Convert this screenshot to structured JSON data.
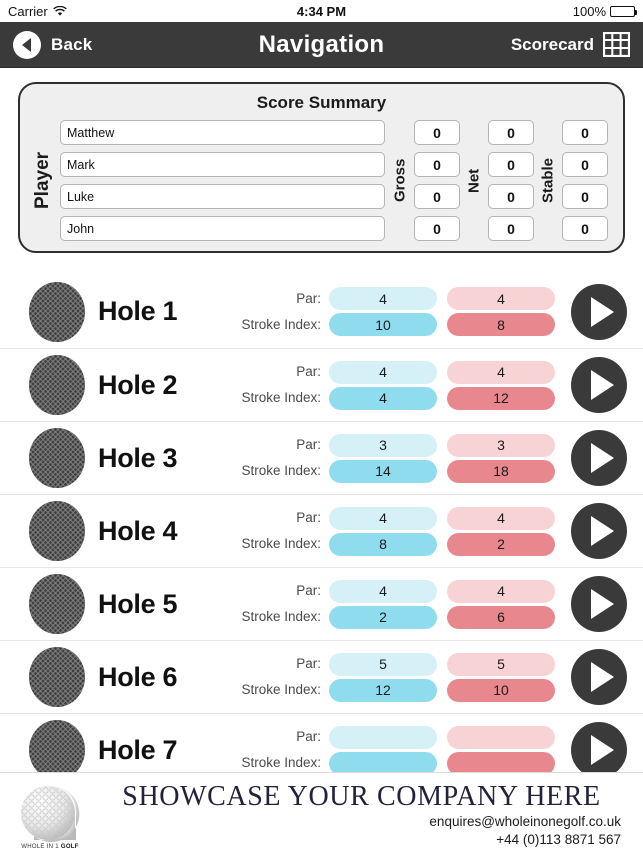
{
  "status_bar": {
    "carrier": "Carrier",
    "wifi_icon": "wifi-icon",
    "time": "4:34 PM",
    "battery_percent": "100%",
    "battery_icon": "battery-full-icon"
  },
  "nav_bar": {
    "back_label": "Back",
    "back_icon": "back-arrow-icon",
    "title": "Navigation",
    "right_label": "Scorecard",
    "right_icon": "grid-icon"
  },
  "score_summary": {
    "title": "Score Summary",
    "player_label": "Player",
    "gross_label": "Gross",
    "net_label": "Net",
    "stable_label": "Stable",
    "rows": [
      {
        "player": "Matthew",
        "gross": "0",
        "net": "0",
        "stable": "0"
      },
      {
        "player": "Mark",
        "gross": "0",
        "net": "0",
        "stable": "0"
      },
      {
        "player": "Luke",
        "gross": "0",
        "net": "0",
        "stable": "0"
      },
      {
        "player": "John",
        "gross": "0",
        "net": "0",
        "stable": "0"
      }
    ]
  },
  "holes": {
    "par_label": "Par:",
    "stroke_index_label": "Stroke Index:",
    "ball_icon": "golf-ball-icon",
    "play_icon": "play-icon",
    "items": [
      {
        "name": "Hole 1",
        "par_blue": "4",
        "si_blue": "10",
        "par_pink": "4",
        "si_pink": "8"
      },
      {
        "name": "Hole 2",
        "par_blue": "4",
        "si_blue": "4",
        "par_pink": "4",
        "si_pink": "12"
      },
      {
        "name": "Hole 3",
        "par_blue": "3",
        "si_blue": "14",
        "par_pink": "3",
        "si_pink": "18"
      },
      {
        "name": "Hole 4",
        "par_blue": "4",
        "si_blue": "8",
        "par_pink": "4",
        "si_pink": "2"
      },
      {
        "name": "Hole 5",
        "par_blue": "4",
        "si_blue": "2",
        "par_pink": "4",
        "si_pink": "6"
      },
      {
        "name": "Hole 6",
        "par_blue": "5",
        "si_blue": "12",
        "par_pink": "5",
        "si_pink": "10"
      },
      {
        "name": "Hole 7",
        "par_blue": "",
        "si_blue": "",
        "par_pink": "",
        "si_pink": ""
      }
    ]
  },
  "footer": {
    "logo_icon": "golf-ball-logo-icon",
    "logo_text_a": "WHOLE IN 1 ",
    "logo_text_b": "GOLF",
    "headline": "SHOWCASE YOUR COMPANY HERE",
    "email": "enquires@wholeinonegolf.co.uk",
    "phone": "+44 (0)113 8871 567"
  },
  "colors": {
    "nav_bg": "#3a3a3a",
    "pill_blue_light": "#d6f0f7",
    "pill_blue": "#8fdcef",
    "pill_pink_light": "#f7d3d5",
    "pill_pink": "#e9878e",
    "footer_headline": "#23223c"
  }
}
